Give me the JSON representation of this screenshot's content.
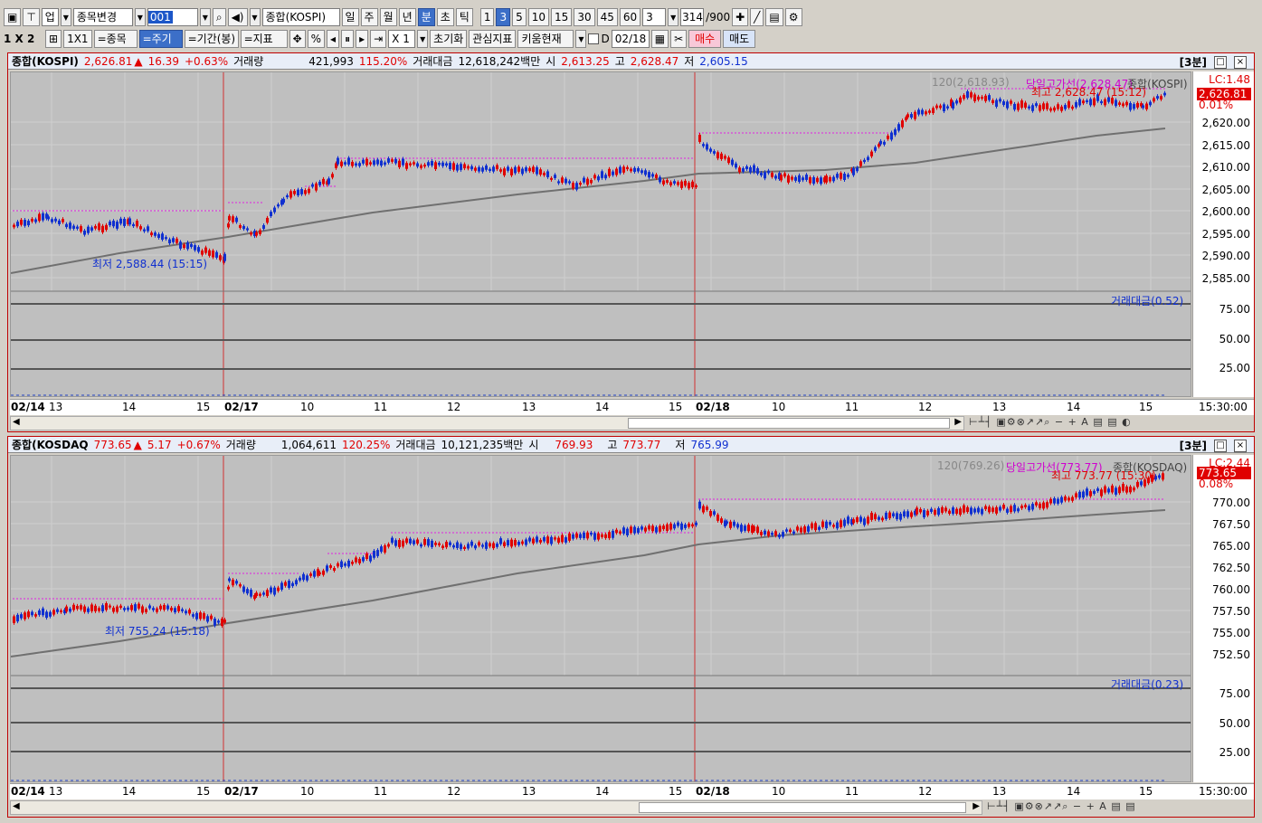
{
  "toolbar1": {
    "market_label": "업",
    "symbol_change": "종목변경",
    "code": "001",
    "symbol_name": "종합(KOSPI)",
    "periods": [
      "일",
      "주",
      "월",
      "년",
      "분",
      "초",
      "틱"
    ],
    "active_period": "분",
    "intervals": [
      "1",
      "3",
      "5",
      "10",
      "15",
      "30",
      "45",
      "60"
    ],
    "active_interval": "3",
    "interval_select": "3",
    "count": "314",
    "count_max": "/900"
  },
  "toolbar2": {
    "layout": "1 X 2",
    "ratio": "1X1",
    "item_btn": "=종목",
    "cycle_btn": "=주기",
    "range_btn": "=기간(봉)",
    "indicator_btn": "=지표",
    "percent": "%",
    "zoom": "X 1",
    "reset_btn": "초기화",
    "watch_btn": "관심지표",
    "kiwoom_btn": "키움현재",
    "d_label": "D",
    "date": "02/18",
    "buy_btn": "매수",
    "sell_btn": "매도"
  },
  "chart1": {
    "header": {
      "name": "종합(KOSPI)",
      "price": "2,626.81",
      "arrow": "▲",
      "change": "16.39",
      "pct": "+0.63%",
      "vol_label": "거래량",
      "volume": "421,993",
      "vol_pct": "115.20%",
      "amt_label": "거래대금",
      "amount": "12,618,242백만",
      "open_label": "시",
      "open": "2,613.25",
      "high_label": "고",
      "high": "2,628.47",
      "low_label": "저",
      "low": "2,605.15",
      "interval_tag": "[3분]"
    },
    "legend_ma": "120(2,618.93)",
    "legend_high": "당일고가선(2,628.47)",
    "legend_name": "종합(KOSPI)",
    "lc": "LC:1.48",
    "price_tag": "2,626.81",
    "pct_tag": "0.01%",
    "max_label": "최고 2,628.47 (15:12)",
    "min_label": "최저 2,588.44 (15:15)",
    "y_ticks": [
      "2,620.00",
      "2,615.00",
      "2,610.00",
      "2,605.00",
      "2,600.00",
      "2,595.00",
      "2,590.00",
      "2,585.00"
    ],
    "sub_legend": "거래대금(0.52)",
    "sub_ticks": [
      "75.00",
      "50.00",
      "25.00"
    ],
    "x_labels": [
      "02/14",
      "13",
      "14",
      "15",
      "02/17",
      "10",
      "11",
      "12",
      "13",
      "14",
      "15",
      "02/18",
      "10",
      "11",
      "12",
      "13",
      "14",
      "15"
    ],
    "x_time": "15:30:00"
  },
  "chart2": {
    "header": {
      "name": "종합(KOSDAQ",
      "price": "773.65",
      "arrow": "▲",
      "change": "5.17",
      "pct": "+0.67%",
      "vol_label": "거래량",
      "volume": "1,064,611",
      "vol_pct": "120.25%",
      "amt_label": "거래대금",
      "amount": "10,121,235백만",
      "open_label": "시",
      "open": "769.93",
      "high_label": "고",
      "high": "773.77",
      "low_label": "저",
      "low": "765.99",
      "interval_tag": "[3분]"
    },
    "legend_ma": "120(769.26)",
    "legend_high": "당일고가선(773.77)",
    "legend_name": "종합(KOSDAQ)",
    "lc": "LC:2.44",
    "price_tag": "773.65",
    "pct_tag": "0.08%",
    "max_label": "최고 773.77 (15:30)",
    "min_label": "최저 755.24 (15:18)",
    "y_ticks": [
      "770.00",
      "767.50",
      "765.00",
      "762.50",
      "760.00",
      "757.50",
      "755.00",
      "752.50"
    ],
    "sub_legend": "거래대금(0.23)",
    "sub_ticks": [
      "75.00",
      "50.00",
      "25.00"
    ],
    "x_labels": [
      "02/14",
      "13",
      "14",
      "15",
      "02/17",
      "10",
      "11",
      "12",
      "13",
      "14",
      "15",
      "02/18",
      "10",
      "11",
      "12",
      "13",
      "14",
      "15"
    ],
    "x_time": "15:30:00"
  }
}
